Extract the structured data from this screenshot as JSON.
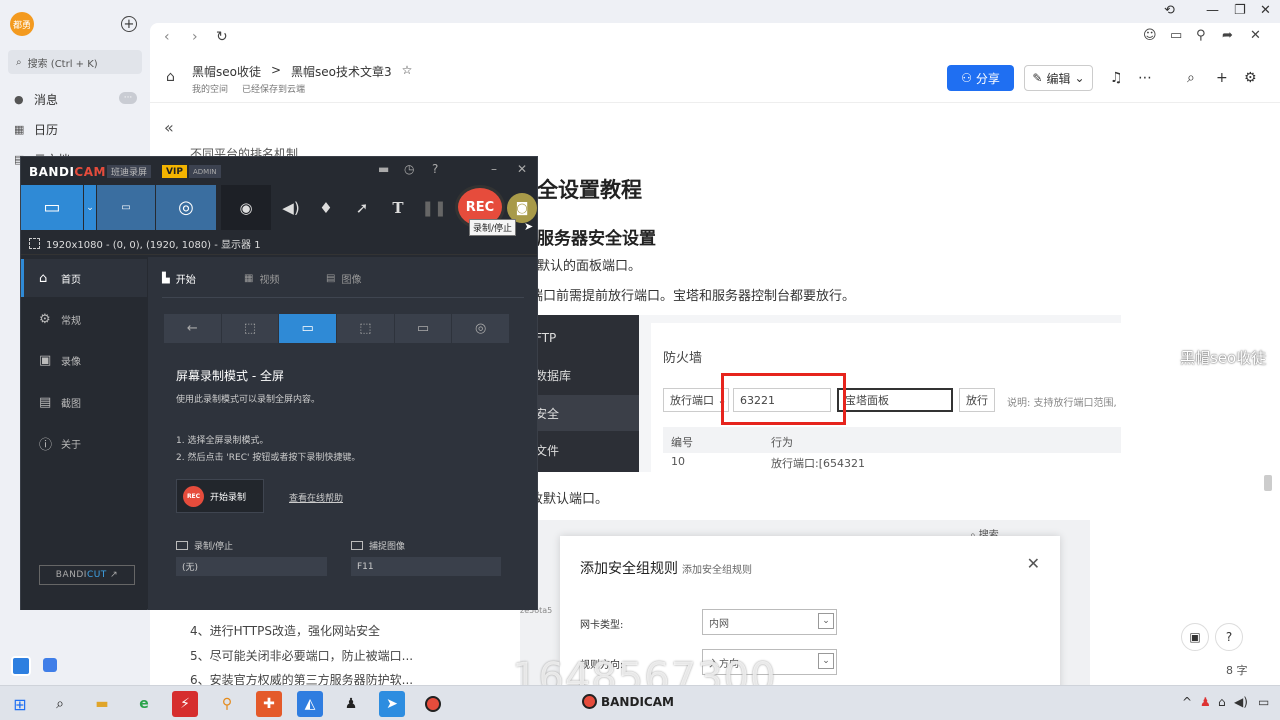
{
  "app": {
    "avatar_text": "都勇",
    "search_placeholder": "搜索 (Ctrl + K)",
    "sidebar_items": [
      {
        "label": "消息",
        "icon": "message-icon"
      },
      {
        "label": "日历",
        "icon": "calendar-icon"
      },
      {
        "label": "云文档",
        "icon": "document-icon"
      }
    ],
    "message_badge": "···"
  },
  "browser": {
    "breadcrumb_parent": "黑帽seo收徒",
    "breadcrumb_sep": ">",
    "doc_title": "黑帽seo技术文章3",
    "space_label": "我的空间",
    "save_status": "已经保存到云端",
    "share_label": "分享",
    "edit_label": "编辑"
  },
  "document": {
    "truncated_top": "不同平台的排名机制",
    "heading1": "全设置教程",
    "heading2": "服务器安全设置",
    "line1": "默认的面板端口。",
    "line2": "端口前需提前放行端口。宝塔和服务器控制台都要放行。",
    "line3": "改默认端口。",
    "list": [
      "4、进行HTTPS改造，强化网站安全",
      "5、尽可能关闭非必要端口，防止被端口...",
      "6、安装官方权威的第三方服务器防护软..."
    ],
    "word_count": "8 字",
    "watermark_right": "黑帽seo收徒",
    "watermark_number": "1648567300"
  },
  "firewall_image": {
    "menu": [
      "FTP",
      "数据库",
      "安全",
      "文件"
    ],
    "title": "防火墙",
    "select_label": "放行端口",
    "port_value": "63221",
    "remark_value": "宝塔面板",
    "allow_button": "放行",
    "note": "说明: 支持放行端口范围,",
    "col_id": "编号",
    "col_action": "行为",
    "row_id": "10",
    "row_action": "放行端口:[654321"
  },
  "dialog_image": {
    "title": "添加安全组规则",
    "subtitle": "添加安全组规则",
    "search_hint": "搜索",
    "nic_label": "网卡类型:",
    "nic_value": "内网",
    "dir_label": "规则方向:",
    "dir_value": "入方向",
    "side_text": "ze5ota5"
  },
  "bandicam": {
    "logo_main": "BANDI",
    "logo_accent": "CAM",
    "cn_name": "班迪录屏",
    "vip": "VIP",
    "admin": "ADMIN",
    "rec_label": "REC",
    "tooltip": "录制/停止",
    "resolution": "1920x1080 - (0, 0), (1920, 1080) - 显示器 1",
    "nav": [
      "首页",
      "常规",
      "录像",
      "截图",
      "关于"
    ],
    "tabs": [
      "开始",
      "视频",
      "图像"
    ],
    "mode_title": "屏幕录制模式 - 全屏",
    "mode_desc": "使用此录制模式可以录制全屏内容。",
    "step1": "1. 选择全屏录制模式。",
    "step2": "2. 然后点击 'REC' 按钮或者按下录制快捷键。",
    "start_label": "开始录制",
    "help_link": "查看在线帮助",
    "hotkey_rec_label": "录制/停止",
    "hotkey_rec_value": "(无)",
    "hotkey_cap_label": "捕捉图像",
    "hotkey_cap_value": "F11",
    "bandicut_main": "BANDI",
    "bandicut_accent": "CUT"
  },
  "taskbar": {
    "bandicam_label": "BANDICAM"
  }
}
